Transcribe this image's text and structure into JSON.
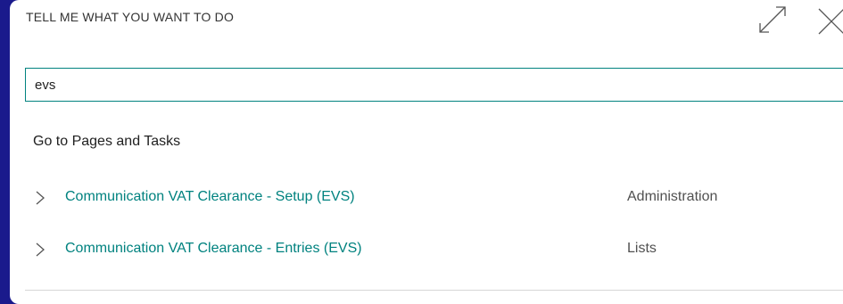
{
  "dialog": {
    "title": "TELL ME WHAT YOU WANT TO DO",
    "expand_icon": "expand-icon",
    "close_icon": "close-icon"
  },
  "search": {
    "value": "evs",
    "placeholder": ""
  },
  "results": {
    "heading": "Go to Pages and Tasks",
    "items": [
      {
        "name": "Communication VAT Clearance - Setup (EVS)",
        "category": "Administration"
      },
      {
        "name": "Communication VAT Clearance - Entries (EVS)",
        "category": "Lists"
      }
    ]
  },
  "colors": {
    "backdrop": "#1a1a8c",
    "accent": "#00827f",
    "text": "#212121",
    "muted": "#505050"
  }
}
